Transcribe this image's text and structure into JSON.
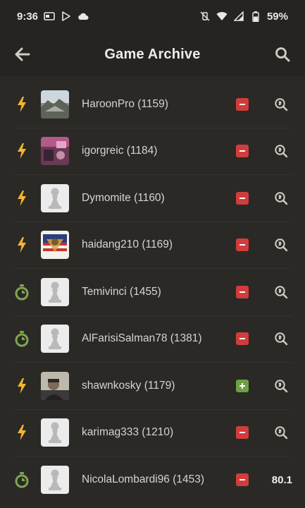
{
  "status_bar": {
    "time": "9:36",
    "battery": "59%"
  },
  "app_bar": {
    "title": "Game Archive",
    "back_icon": "arrow-left-icon",
    "search_icon": "search-icon"
  },
  "colors": {
    "background": "#2b2926",
    "bar": "#262421",
    "bolt": "#f2b631",
    "clock": "#7fa650",
    "loss": "#d23c3c",
    "win": "#6fa043"
  },
  "games": [
    {
      "mode": "blitz",
      "mode_icon": "lightning-bolt-icon",
      "avatar": "photo-landscape",
      "player": "HaroonPro (1159)",
      "result": "loss",
      "action": "review"
    },
    {
      "mode": "blitz",
      "mode_icon": "lightning-bolt-icon",
      "avatar": "photo-room",
      "player": "igorgreic (1184)",
      "result": "loss",
      "action": "review"
    },
    {
      "mode": "blitz",
      "mode_icon": "lightning-bolt-icon",
      "avatar": "pawn",
      "player": "Dymomite (1160)",
      "result": "loss",
      "action": "review"
    },
    {
      "mode": "blitz",
      "mode_icon": "lightning-bolt-icon",
      "avatar": "flag-crest",
      "player": "haidang210 (1169)",
      "result": "loss",
      "action": "review"
    },
    {
      "mode": "rapid",
      "mode_icon": "stopwatch-icon",
      "avatar": "pawn",
      "player": "Temivinci (1455)",
      "result": "loss",
      "action": "review"
    },
    {
      "mode": "rapid",
      "mode_icon": "stopwatch-icon",
      "avatar": "pawn",
      "player": "AlFarisiSalman78 (1381)",
      "result": "loss",
      "action": "review"
    },
    {
      "mode": "blitz",
      "mode_icon": "lightning-bolt-icon",
      "avatar": "photo-person",
      "player": "shawnkosky (1179)",
      "result": "win",
      "action": "review"
    },
    {
      "mode": "blitz",
      "mode_icon": "lightning-bolt-icon",
      "avatar": "pawn",
      "player": "karimag333 (1210)",
      "result": "loss",
      "action": "review"
    },
    {
      "mode": "rapid",
      "mode_icon": "stopwatch-icon",
      "avatar": "pawn",
      "player": "NicolaLombardi96 (1453)",
      "result": "loss",
      "action": "accuracy",
      "accuracy": "80.1"
    }
  ]
}
